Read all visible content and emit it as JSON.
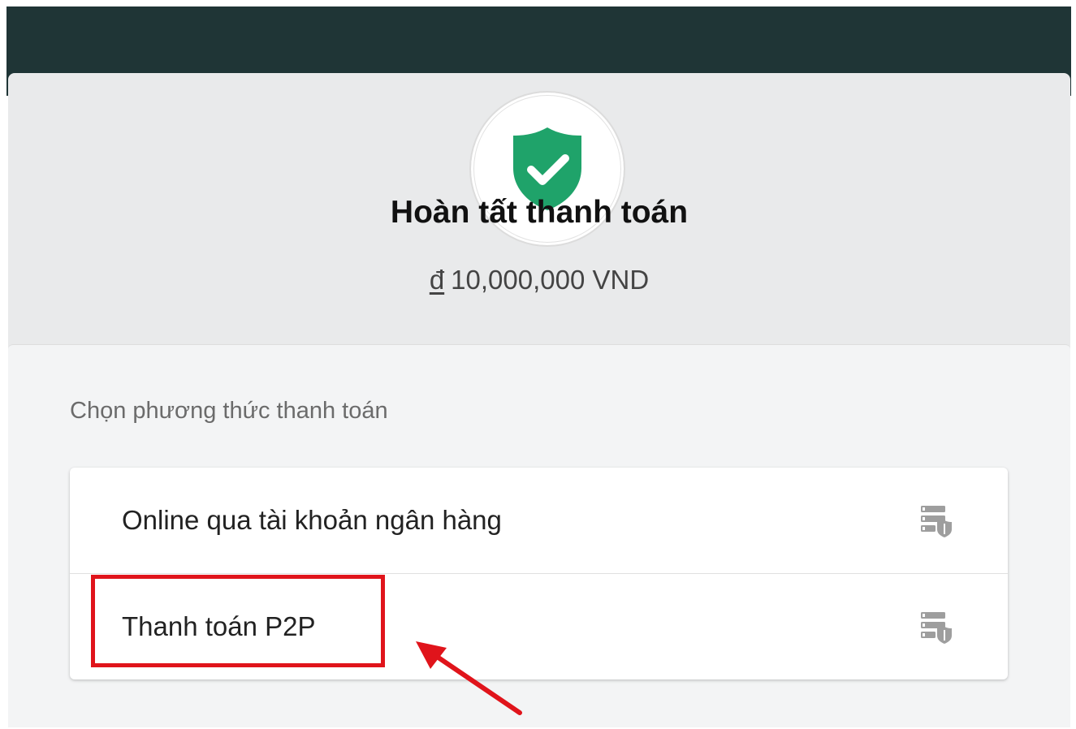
{
  "header": {
    "title": "Hoàn tất thanh toán",
    "amount": {
      "currency_symbol": "đ",
      "value": "10,000,000 VND"
    },
    "icon": "shield-check-icon"
  },
  "payment": {
    "section_label": "Chọn phương thức thanh toán",
    "methods": [
      {
        "label": "Online qua tài khoản ngân hàng",
        "icon": "server-shield-icon"
      },
      {
        "label": "Thanh toán P2P",
        "icon": "server-shield-icon"
      }
    ]
  },
  "annotation": {
    "color": "#e0141b"
  },
  "colors": {
    "topbar": "#1f3536",
    "shield": "#1fa36a",
    "card": "#e9eaeb"
  }
}
